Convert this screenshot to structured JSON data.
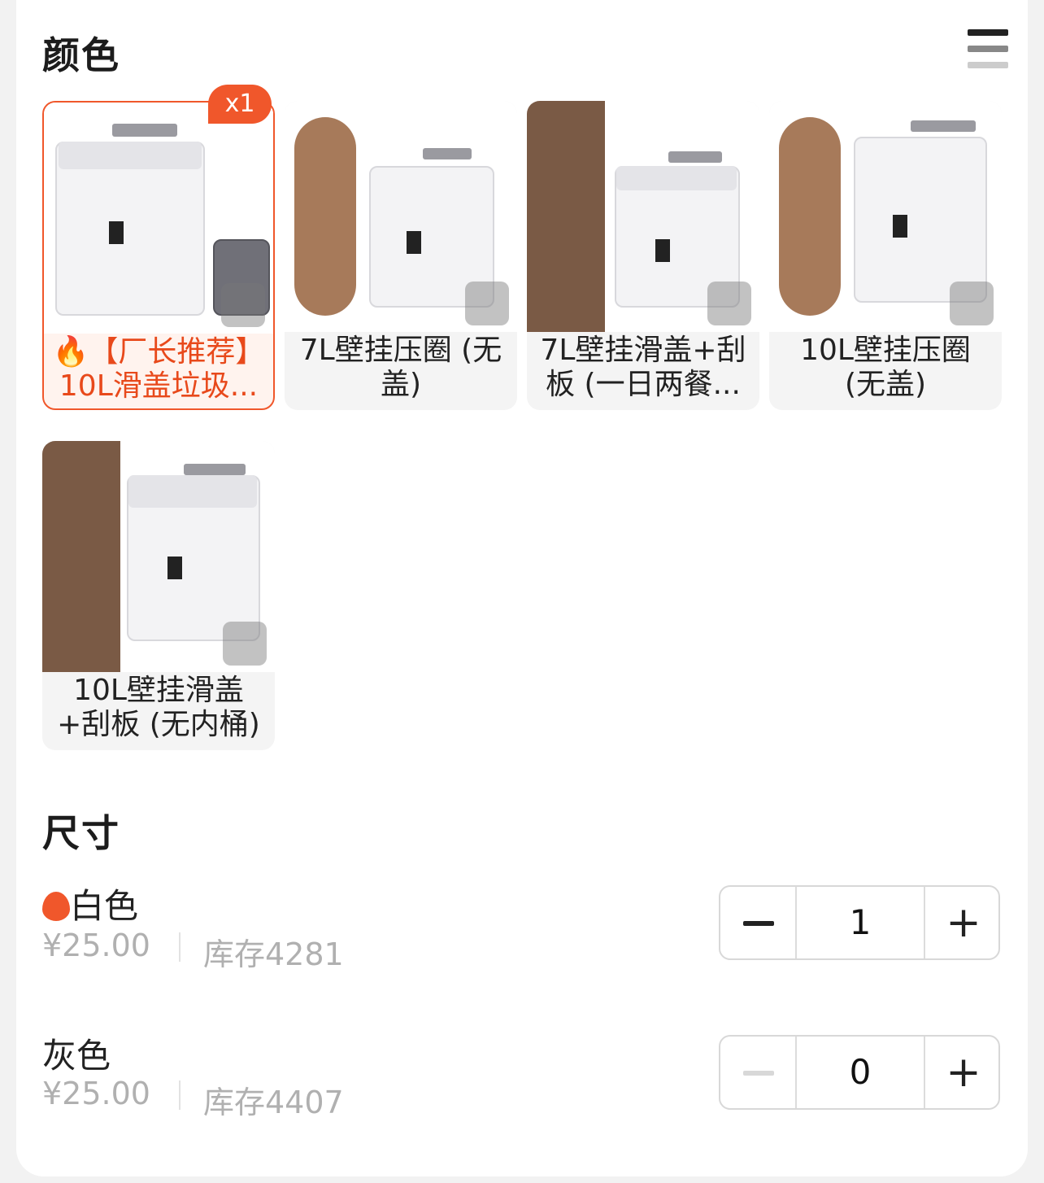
{
  "color_section": {
    "title": "颜色",
    "menu_icon": "list-icon"
  },
  "selected_badge": "x1",
  "colors": [
    {
      "label": "🔥【厂长推荐】10L滑盖垃圾...",
      "selected": true
    },
    {
      "label": "7L壁挂压圈 (无盖)",
      "selected": false,
      "badge_size": "7L"
    },
    {
      "label": "7L壁挂滑盖+刮板 (一日两餐...",
      "selected": false,
      "badge_size": "7L"
    },
    {
      "label": "10L壁挂压圈 (无盖)",
      "selected": false,
      "badge_size": "10L"
    },
    {
      "label": "10L壁挂滑盖+刮板 (无内桶)",
      "selected": false,
      "badge_size": "10L"
    }
  ],
  "size_section": {
    "title": "尺寸"
  },
  "sizes": [
    {
      "name": "白色",
      "hot": true,
      "price": "¥25.00",
      "stock": "库存4281",
      "qty": "1",
      "minus_enabled": true
    },
    {
      "name": "灰色",
      "hot": false,
      "price": "¥25.00",
      "stock": "库存4407",
      "qty": "0",
      "minus_enabled": false
    }
  ],
  "colors_theme": {
    "accent": "#f0572b",
    "muted": "#b0b0b0"
  }
}
